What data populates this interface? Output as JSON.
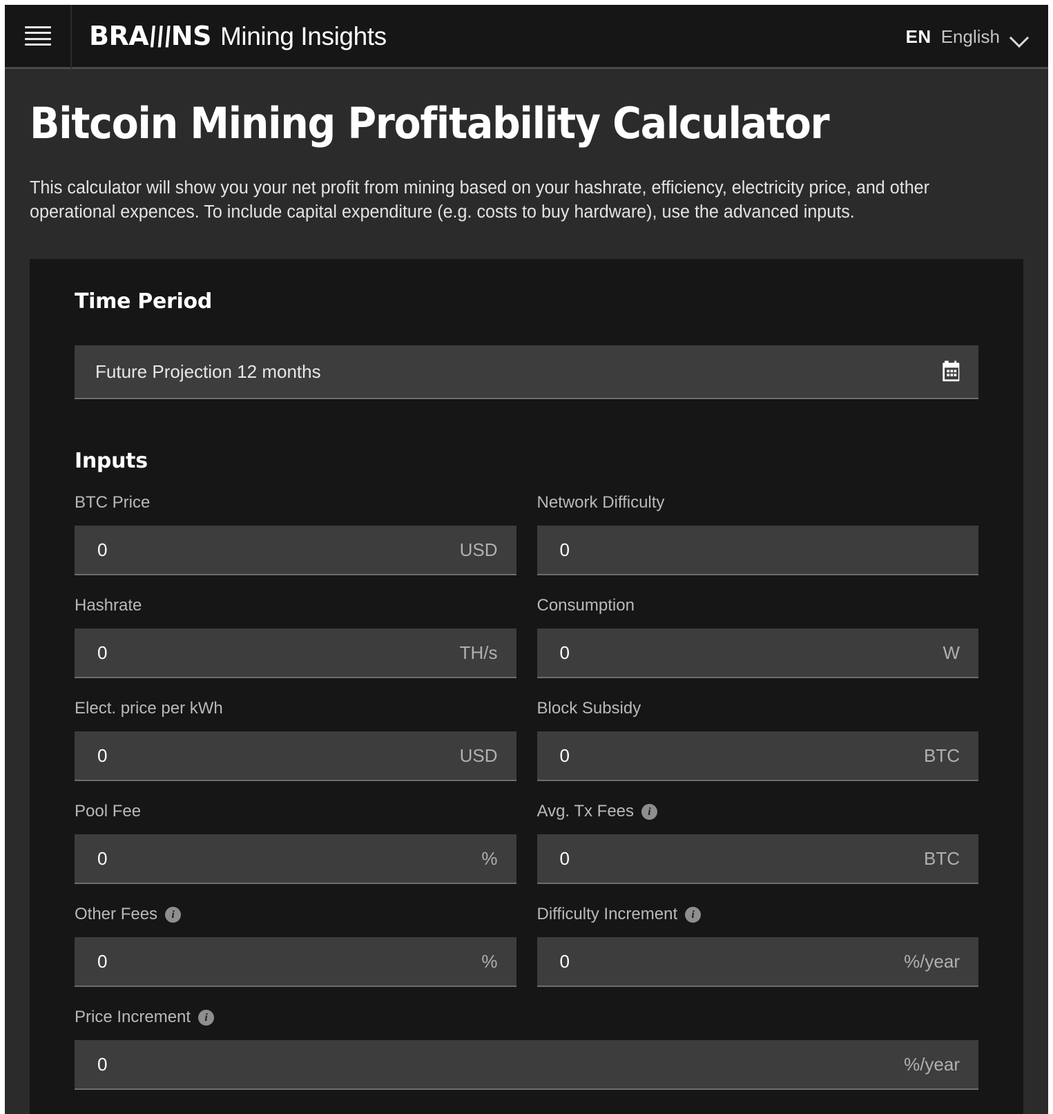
{
  "header": {
    "menu_icon": "hamburger-menu-icon",
    "brand_prefix": "BRA",
    "brand_slashes": "\\\\\\",
    "brand_suffix": "NS",
    "brand_rest": "Mining Insights",
    "language_code": "EN",
    "language_name": "English",
    "language_chevron": "chevron-down-icon"
  },
  "main": {
    "title": "Bitcoin Mining Profitability Calculator",
    "description": "This calculator will show you your net profit from mining based on your hashrate, efficiency, electricity price, and other operational expences. To include capital expenditure (e.g. costs to buy hardware), use the advanced inputs."
  },
  "time_period": {
    "section_title": "Time Period",
    "value": "Future Projection 12 months",
    "icon": "calendar-icon"
  },
  "inputs": {
    "section_title": "Inputs",
    "fields": [
      {
        "label": "BTC Price",
        "value": "0",
        "unit": "USD",
        "info": false,
        "full": false
      },
      {
        "label": "Network Difficulty",
        "value": "0",
        "unit": "",
        "info": false,
        "full": false
      },
      {
        "label": "Hashrate",
        "value": "0",
        "unit": "TH/s",
        "info": false,
        "full": false
      },
      {
        "label": "Consumption",
        "value": "0",
        "unit": "W",
        "info": false,
        "full": false
      },
      {
        "label": "Elect. price per kWh",
        "value": "0",
        "unit": "USD",
        "info": false,
        "full": false
      },
      {
        "label": "Block Subsidy",
        "value": "0",
        "unit": "BTC",
        "info": false,
        "full": false
      },
      {
        "label": "Pool Fee",
        "value": "0",
        "unit": "%",
        "info": false,
        "full": false
      },
      {
        "label": "Avg. Tx Fees",
        "value": "0",
        "unit": "BTC",
        "info": true,
        "full": false
      },
      {
        "label": "Other Fees",
        "value": "0",
        "unit": "%",
        "info": true,
        "full": false
      },
      {
        "label": "Difficulty Increment",
        "value": "0",
        "unit": "%/year",
        "info": true,
        "full": false
      },
      {
        "label": "Price Increment",
        "value": "0",
        "unit": "%/year",
        "info": true,
        "full": true
      }
    ]
  },
  "colors": {
    "page_bg": "#2b2b2b",
    "card_bg": "#161616",
    "topbar_bg": "#161616",
    "input_bg": "#3d3d3d",
    "input_underline": "#6d6d6d",
    "text_primary": "#ffffff",
    "text_muted": "#b9b9b9"
  }
}
